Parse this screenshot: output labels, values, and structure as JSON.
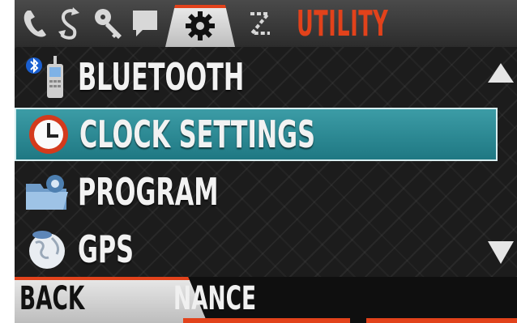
{
  "header": {
    "title": "UTILITY",
    "tabs": [
      {
        "icon": "phone-icon"
      },
      {
        "icon": "sync-icon"
      },
      {
        "icon": "key-icon"
      },
      {
        "icon": "message-icon"
      },
      {
        "icon": "gear-icon",
        "active": true
      },
      {
        "icon": "tools-icon"
      }
    ],
    "accent_color": "#e2421b"
  },
  "menu": {
    "items": [
      {
        "label": "BLUETOOTH",
        "icon": "bluetooth-phone-icon"
      },
      {
        "label": "CLOCK SETTINGS",
        "icon": "clock-icon",
        "selected": true
      },
      {
        "label": "PROGRAM",
        "icon": "program-folder-icon"
      },
      {
        "label": "GPS",
        "icon": "globe-icon"
      }
    ],
    "selected_color": "#2a8a95"
  },
  "softkeys": {
    "left": "BACK",
    "middle": "NANCE"
  }
}
